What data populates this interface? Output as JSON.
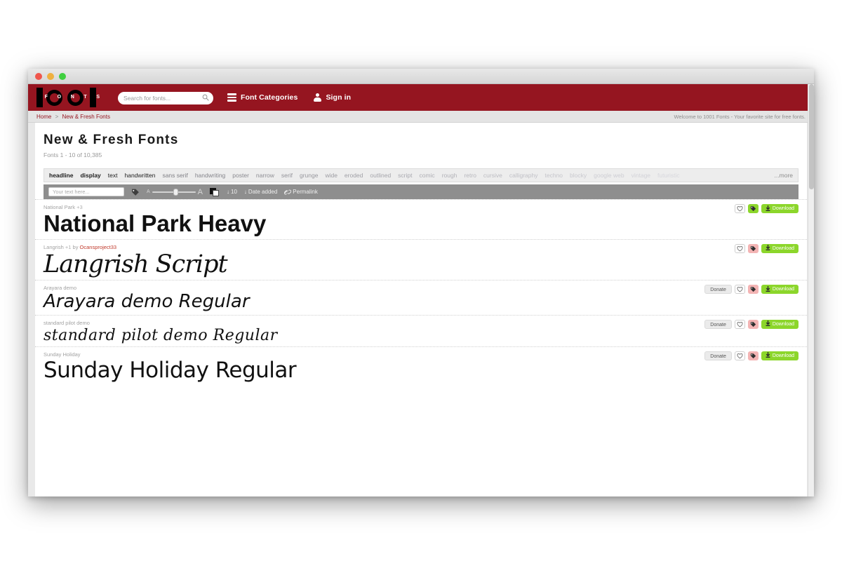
{
  "window": {
    "traffic_lights": [
      "close",
      "minimize",
      "maximize"
    ]
  },
  "header": {
    "logo_digits": "1001",
    "logo_letters": [
      "F",
      "O",
      "N",
      "T",
      "S"
    ],
    "search": {
      "placeholder": "Search for fonts...",
      "value": "",
      "icon": "search-icon"
    },
    "font_categories_label": "Font Categories",
    "font_categories_icon": "hamburger-icon",
    "sign_in_label": "Sign in",
    "sign_in_icon": "person-icon",
    "brand_color": "#951520"
  },
  "breadcrumb": {
    "home": "Home",
    "separator": ">",
    "current": "New & Fresh Fonts",
    "welcome": "Welcome to 1001 Fonts - Your favorite site for free fonts."
  },
  "main": {
    "title": "New & Fresh Fonts",
    "result_count": "Fonts 1 - 10 of 10,385"
  },
  "tag_bar": {
    "tags": [
      "headline",
      "display",
      "text",
      "handwritten",
      "sans serif",
      "handwriting",
      "poster",
      "narrow",
      "serif",
      "grunge",
      "wide",
      "eroded",
      "outlined",
      "script",
      "comic",
      "rough",
      "retro",
      "cursive",
      "calligraphy",
      "techno",
      "blocky",
      "google web",
      "vintage",
      "futuristic"
    ],
    "more_label": "...more"
  },
  "controls": {
    "preview_placeholder": "Your text here...",
    "preview_value": "",
    "tag_icon": "tag-icon",
    "slider_small_label": "A",
    "slider_big_label": "A",
    "slider_value": 48,
    "contrast_icon": "contrast-icon",
    "per_page_label": "10",
    "per_page_icon": "sort-down-icon",
    "sort_label": "Date added",
    "sort_icon": "sort-down-icon",
    "permalink_label": "Permalink",
    "permalink_icon": "link-icon"
  },
  "font_rows": [
    {
      "name": "National Park",
      "extra_styles": "+3",
      "by_label": "",
      "author": "",
      "specimen": "National Park Heavy",
      "style_class": "sp-heavy",
      "has_donate": false,
      "donate_label": "Donate",
      "tag_color": "green",
      "download_label": "Download"
    },
    {
      "name": "Langrish",
      "extra_styles": "+1",
      "by_label": "by",
      "author": "Ocansproject33",
      "specimen": "Langrish Script",
      "style_class": "sp-script",
      "has_donate": false,
      "donate_label": "Donate",
      "tag_color": "pink",
      "download_label": "Download"
    },
    {
      "name": "Arayara demo",
      "extra_styles": "",
      "by_label": "",
      "author": "",
      "specimen": "Arayara demo Regular",
      "style_class": "sp-hand",
      "has_donate": true,
      "donate_label": "Donate",
      "tag_color": "pink",
      "download_label": "Download"
    },
    {
      "name": "standard pilot demo",
      "extra_styles": "",
      "by_label": "",
      "author": "",
      "specimen": "standard pilot demo Regular",
      "style_class": "sp-thin",
      "has_donate": true,
      "donate_label": "Donate",
      "tag_color": "pink",
      "download_label": "Download"
    },
    {
      "name": "Sunday Holiday",
      "extra_styles": "",
      "by_label": "",
      "author": "",
      "specimen": "Sunday Holiday Regular",
      "style_class": "sp-marker",
      "has_donate": true,
      "donate_label": "Donate",
      "tag_color": "pink",
      "download_label": "Download"
    }
  ],
  "colors": {
    "brand_red": "#951520",
    "download_green": "#8cd62b",
    "tag_pink": "#f3b4b4",
    "link_red": "#c0392b",
    "toolbar_gray": "#8e8e8e"
  }
}
